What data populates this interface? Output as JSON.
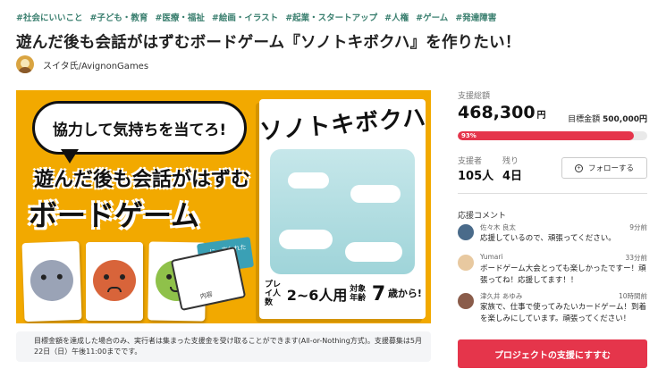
{
  "tags": [
    "#社会にいいこと",
    "#子ども・教育",
    "#医療・福祉",
    "#絵画・イラスト",
    "#起業・スタートアップ",
    "#人権",
    "#ゲーム",
    "#発達障害"
  ],
  "title": "遊んだ後も会話がはずむボードゲーム『ソノトキボクハ』を作りたい！",
  "owner": {
    "name": "スイタ氏/AvignonGames"
  },
  "hero": {
    "bubble": "協力して気持ちを当てろ!",
    "line1": "遊んだ後も会話がはずむ",
    "line2": "ボードゲーム",
    "box_title": "ソノトキボクハ",
    "mini_card_label": "…に、言われた",
    "mini_card2_label": "内容",
    "players_label": "プレイ人数",
    "players_value": "2~6人用",
    "age_label": "対象年齢",
    "age_value": "7",
    "age_suffix": "歳から!"
  },
  "notice": "目標金額を達成した場合のみ、実行者は集まった支援金を受け取ることができます(All-or-Nothing方式)。支援募集は5月22日（日）午後11:00までです。",
  "panel": {
    "raised_label": "支援総額",
    "raised_value": "468,300",
    "raised_unit": "円",
    "goal_label": "目標金額",
    "goal_value": "500,000円",
    "progress_text": "93%",
    "progress_fraction": 0.93,
    "backers_label": "支援者",
    "backers_value": "105人",
    "remaining_label": "残り",
    "remaining_value": "4日",
    "follow_label": "フォローする",
    "comments_heading": "応援コメント",
    "comments": [
      {
        "name": "佐々木 良太",
        "time": "9分前",
        "text": "応援しているので、頑張ってください。",
        "avatar_color": "#4a6b8a"
      },
      {
        "name": "Yumari",
        "time": "33分前",
        "text": "ボードゲーム大会とっても楽しかったですー！頑張ってね！応援してます！！",
        "avatar_color": "#e8c9a0"
      },
      {
        "name": "津久井 あゆみ",
        "time": "10時間前",
        "text": "家族で、仕事で使ってみたいカードゲーム！到着を楽しみにしています。頑張ってください！",
        "avatar_color": "#8a5c4a"
      }
    ],
    "support_button": "プロジェクトの支援にすすむ"
  },
  "colors": {
    "accent": "#e5354b",
    "tag": "#3a7f6f",
    "hero_bg": "#f2a900"
  }
}
